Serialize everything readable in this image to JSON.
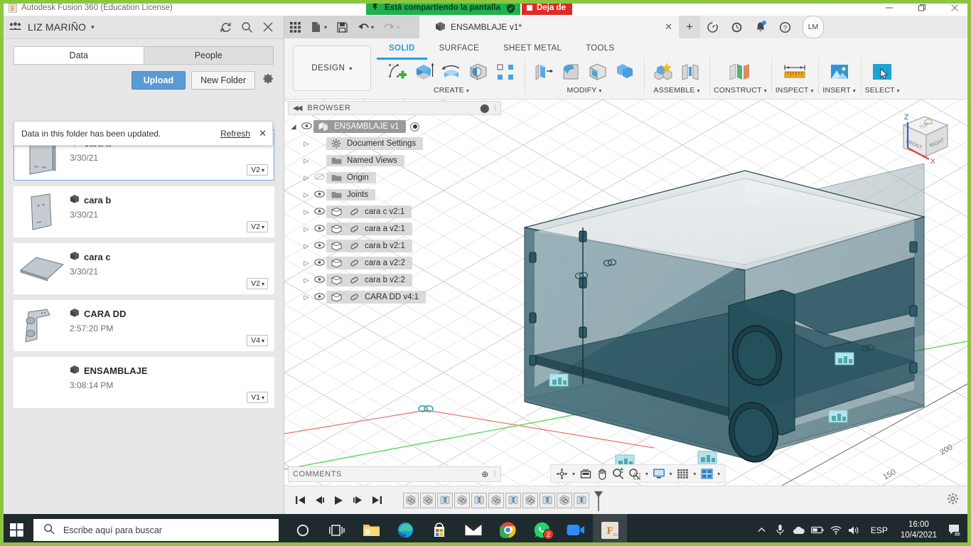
{
  "titlebar": {
    "app_title": "Autodesk Fusion 360 (Education License)",
    "app_icon": "fusion-logo-icon",
    "minimize": "–",
    "maximize": "❐",
    "close": "✕"
  },
  "screen_share": {
    "message": "Está compartiendo la pantalla",
    "stop_label": "Deja de",
    "cast_icon": "cast-icon",
    "shield_icon": "shield-check-icon",
    "green": "#22b14c",
    "red": "#e02a26",
    "border_color": "#8cc63f"
  },
  "data_panel": {
    "team_name": "LIZ MARIÑO",
    "team_icon": "team-icon",
    "caret": "▾",
    "header_icons": [
      "refresh-icon",
      "search-icon",
      "close-icon"
    ],
    "tabs": [
      {
        "label": "Data",
        "active": true
      },
      {
        "label": "People",
        "active": false
      }
    ],
    "upload_label": "Upload",
    "new_folder_label": "New Folder",
    "settings_icon": "gear-icon",
    "notice": {
      "message": "Data in this folder has been updated.",
      "refresh_label": "Refresh",
      "close": "✕"
    },
    "items": [
      {
        "name": "cara a",
        "date": "3/30/21",
        "version": "V2",
        "selected": true,
        "thumb": "panel-a"
      },
      {
        "name": "cara b",
        "date": "3/30/21",
        "version": "V2",
        "selected": false,
        "thumb": "panel-b"
      },
      {
        "name": "cara c",
        "date": "3/30/21",
        "version": "V2",
        "selected": false,
        "thumb": "plate-c"
      },
      {
        "name": "CARA DD",
        "date": "2:57:20 PM",
        "version": "V4",
        "selected": false,
        "thumb": "bracket-dd"
      },
      {
        "name": "ENSAMBLAJE",
        "date": "3:08:14 PM",
        "version": "V1",
        "selected": false,
        "thumb": "none"
      }
    ]
  },
  "quick_access": {
    "buttons": [
      "grid-apps-icon",
      "new-file-icon",
      "save-icon",
      "undo-icon",
      "redo-icon"
    ]
  },
  "document_tab": {
    "title": "ENSAMBLAJE v1*",
    "icon": "component-icon",
    "close": "✕",
    "new_tab": "+",
    "right_icons": [
      "job-status-icon",
      "recent-activity-icon",
      "notifications-icon",
      "help-icon"
    ],
    "avatar_initials": "LM"
  },
  "ribbon": {
    "design_label": "DESIGN",
    "design_caret": "▾",
    "workspace_tabs": [
      {
        "label": "SOLID",
        "active": true
      },
      {
        "label": "SURFACE",
        "active": false
      },
      {
        "label": "SHEET METAL",
        "active": false
      },
      {
        "label": "TOOLS",
        "active": false
      }
    ],
    "groups": [
      {
        "label": "CREATE",
        "caret": "▾",
        "icons": [
          "sketch-create-icon",
          "extrude-icon",
          "revolve-icon",
          "hole-icon",
          "pattern-icon"
        ]
      },
      {
        "label": "MODIFY",
        "caret": "▾",
        "icons": [
          "press-pull-icon",
          "fillet-icon",
          "shell-icon",
          "combine-icon"
        ]
      },
      {
        "label": "ASSEMBLE",
        "caret": "▾",
        "icons": [
          "new-component-icon",
          "joint-icon"
        ]
      },
      {
        "label": "CONSTRUCT",
        "caret": "▾",
        "icons": [
          "offset-plane-icon"
        ]
      },
      {
        "label": "INSPECT",
        "caret": "▾",
        "icons": [
          "measure-icon"
        ]
      },
      {
        "label": "INSERT",
        "caret": "▾",
        "icons": [
          "insert-image-icon"
        ]
      },
      {
        "label": "SELECT",
        "caret": "▾",
        "icons": [
          "select-window-icon"
        ]
      }
    ]
  },
  "browser": {
    "title": "BROWSER",
    "collapse_icon": "collapse-left-icon",
    "dot_icon": "panel-dot-icon",
    "grip_icon": "panel-grip-icon",
    "root": {
      "label": "ENSAMBLAJE v1",
      "icon": "assembly-icon",
      "eye": "visible",
      "radio": "activated"
    },
    "nodes": [
      {
        "label": "Document Settings",
        "icon": "gear-icon",
        "eye": "none",
        "link": false
      },
      {
        "label": "Named Views",
        "icon": "folder-icon",
        "eye": "none",
        "link": false
      },
      {
        "label": "Origin",
        "icon": "folder-icon",
        "eye": "hidden",
        "link": false
      },
      {
        "label": "Joints",
        "icon": "folder-icon",
        "eye": "visible",
        "link": false
      },
      {
        "label": "cara c v2:1",
        "icon": "body-icon",
        "eye": "visible",
        "link": true
      },
      {
        "label": "cara a v2:1",
        "icon": "body-icon",
        "eye": "visible",
        "link": true
      },
      {
        "label": "cara b v2:1",
        "icon": "body-icon",
        "eye": "visible",
        "link": true
      },
      {
        "label": "cara a v2:2",
        "icon": "body-icon",
        "eye": "visible",
        "link": true
      },
      {
        "label": "cara b v2:2",
        "icon": "body-icon",
        "eye": "visible",
        "link": true
      },
      {
        "label": "CARA DD v4:1",
        "icon": "body-icon",
        "eye": "visible",
        "link": true
      }
    ]
  },
  "comments": {
    "label": "COMMENTS",
    "add_icon": "add-comment-icon",
    "grip_icon": "panel-grip-icon"
  },
  "navbar": {
    "buttons": [
      {
        "name": "orbit-icon",
        "caret": true
      },
      {
        "name": "look-at-icon",
        "caret": false
      },
      {
        "name": "pan-icon",
        "caret": false
      },
      {
        "name": "zoom-icon",
        "caret": false
      },
      {
        "name": "zoom-window-icon",
        "caret": true
      },
      {
        "name": "display-settings-icon",
        "caret": true
      },
      {
        "name": "grid-snaps-icon",
        "caret": true
      },
      {
        "name": "viewports-icon",
        "caret": true
      }
    ]
  },
  "viewcube": {
    "faces": [
      "TOP",
      "FRONT",
      "RIGHT"
    ],
    "axes": [
      {
        "label": "Z",
        "color": "#3b5ad8"
      },
      {
        "label": "X",
        "color": "#e0453a"
      }
    ]
  },
  "viewport": {
    "grid_labels": [
      "200",
      "150"
    ],
    "model_name": "ENSAMBLAJE",
    "model_fill": "#2f5a66",
    "model_edge": "#123038",
    "joint_marker_color": "#6fc8cf",
    "green_axis": "#3dd13d",
    "red_axis": "#e05a52"
  },
  "timeline": {
    "playback": [
      "skip-start-icon",
      "step-back-icon",
      "play-icon",
      "step-forward-icon",
      "skip-end-icon"
    ],
    "features": [
      "insert-feature-icon",
      "insert-feature-icon",
      "joint-feature-icon",
      "insert-feature-icon",
      "joint-feature-icon",
      "insert-feature-icon",
      "joint-feature-icon",
      "insert-feature-icon",
      "joint-feature-icon",
      "insert-feature-icon",
      "joint-feature-icon"
    ],
    "marker_icon": "timeline-marker-icon",
    "settings_icon": "gear-icon"
  },
  "taskbar": {
    "start_icon": "windows-start-icon",
    "search_placeholder": "Escribe aquí para buscar",
    "search_icon": "search-icon",
    "apps": [
      {
        "name": "cortana-icon",
        "active": false
      },
      {
        "name": "task-view-icon",
        "active": false
      },
      {
        "name": "file-explorer-icon",
        "active": false
      },
      {
        "name": "edge-icon",
        "active": false
      },
      {
        "name": "microsoft-store-icon",
        "active": false
      },
      {
        "name": "mail-icon",
        "active": false
      },
      {
        "name": "chrome-icon",
        "active": false
      },
      {
        "name": "whatsapp-icon",
        "active": false,
        "badge": "2"
      },
      {
        "name": "zoom-app-icon",
        "active": false
      },
      {
        "name": "fusion360-icon",
        "active": true
      }
    ],
    "tray": [
      "show-hidden-icons-icon",
      "microphone-icon",
      "onedrive-icon",
      "battery-icon",
      "wifi-icon",
      "volume-icon"
    ],
    "language": "ESP",
    "time": "16:00",
    "date": "10/4/2021",
    "action_center_icon": "action-center-icon"
  }
}
